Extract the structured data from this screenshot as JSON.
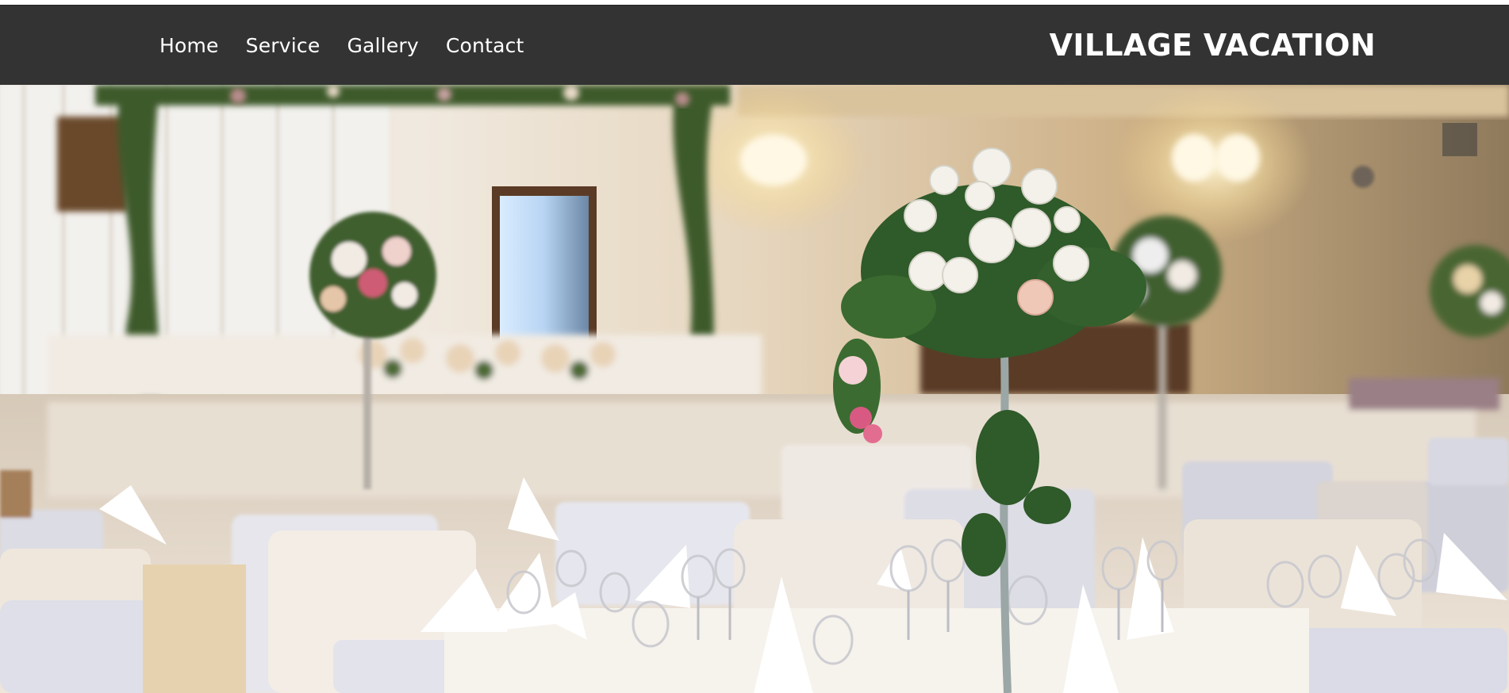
{
  "header": {
    "nav": [
      {
        "label": "Home"
      },
      {
        "label": "Service"
      },
      {
        "label": "Gallery"
      },
      {
        "label": "Contact"
      }
    ],
    "brand": "VILLAGE VACATION"
  },
  "colors": {
    "navbar": "#333333",
    "text": "#ffffff"
  },
  "hero": {
    "image": "wedding-banquet-hall-photo"
  }
}
